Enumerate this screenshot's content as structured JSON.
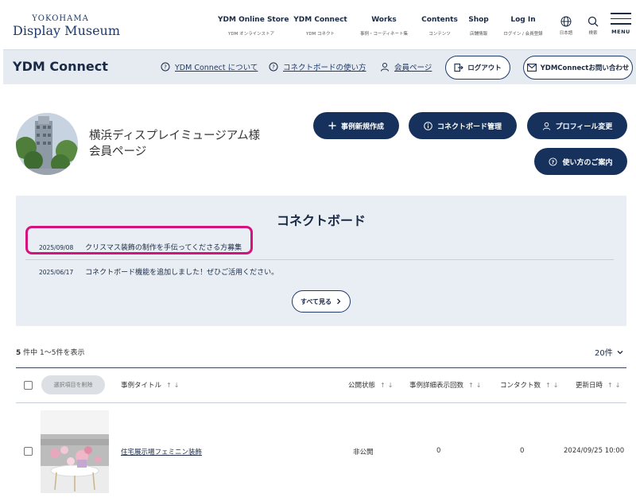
{
  "header": {
    "logo_top": "YOKOHAMA",
    "logo_main": "Display Museum",
    "nav": [
      {
        "title": "YDM Online Store",
        "sub": "YDM オンラインストア"
      },
      {
        "title": "YDM Connect",
        "sub": "YDM コネクト"
      },
      {
        "title": "Works",
        "sub": "事例・コーディネート集"
      },
      {
        "title": "Contents",
        "sub": "コンテンツ"
      },
      {
        "title": "Shop",
        "sub": "店舗情報"
      },
      {
        "title": "Log In",
        "sub": "ログイン / 会員登録"
      }
    ],
    "language_label": "日本語",
    "search_label": "検索",
    "menu_label": "MENU"
  },
  "subbar": {
    "title": "YDM Connect",
    "links": [
      "YDM Connect について",
      "コネクトボードの使い方",
      "会員ページ"
    ],
    "logout_label": "ログアウト",
    "contact_label": "YDMConnectお問い合わせ"
  },
  "profile": {
    "name_line1": "横浜ディスプレイミュージアム様",
    "name_line2": "会員ページ",
    "buttons": {
      "new_case": "事例新規作成",
      "board_manage": "コネクトボード管理",
      "profile_edit": "プロフィール変更",
      "guide": "使い方のご案内"
    }
  },
  "board": {
    "title": "コネクトボード",
    "items": [
      {
        "date": "2025/09/08",
        "text": "クリスマス装飾の制作を手伝ってくださる方募集"
      },
      {
        "date": "2025/06/17",
        "text": "コネクトボード機能を追加しました！ぜひご活用ください。"
      }
    ],
    "see_all": "すべて見る"
  },
  "list": {
    "count_total": "5",
    "count_text": "件中 1〜5件を表示",
    "per_page": "20件",
    "delete_selected": "選択項目を削除",
    "columns": [
      "事例タイトル",
      "公開状態",
      "事例詳細表示回数",
      "コンタクト数",
      "更新日時"
    ],
    "rows": [
      {
        "title": "住宅展示場フェミニン装飾",
        "status": "非公開",
        "views": "0",
        "contacts": "0",
        "updated": "2024/09/25 10:00"
      }
    ]
  },
  "colors": {
    "navy": "#16325c",
    "highlight": "#d4147c",
    "board_bg": "#e9eef4",
    "subbar_bg": "#e6ebf2"
  }
}
